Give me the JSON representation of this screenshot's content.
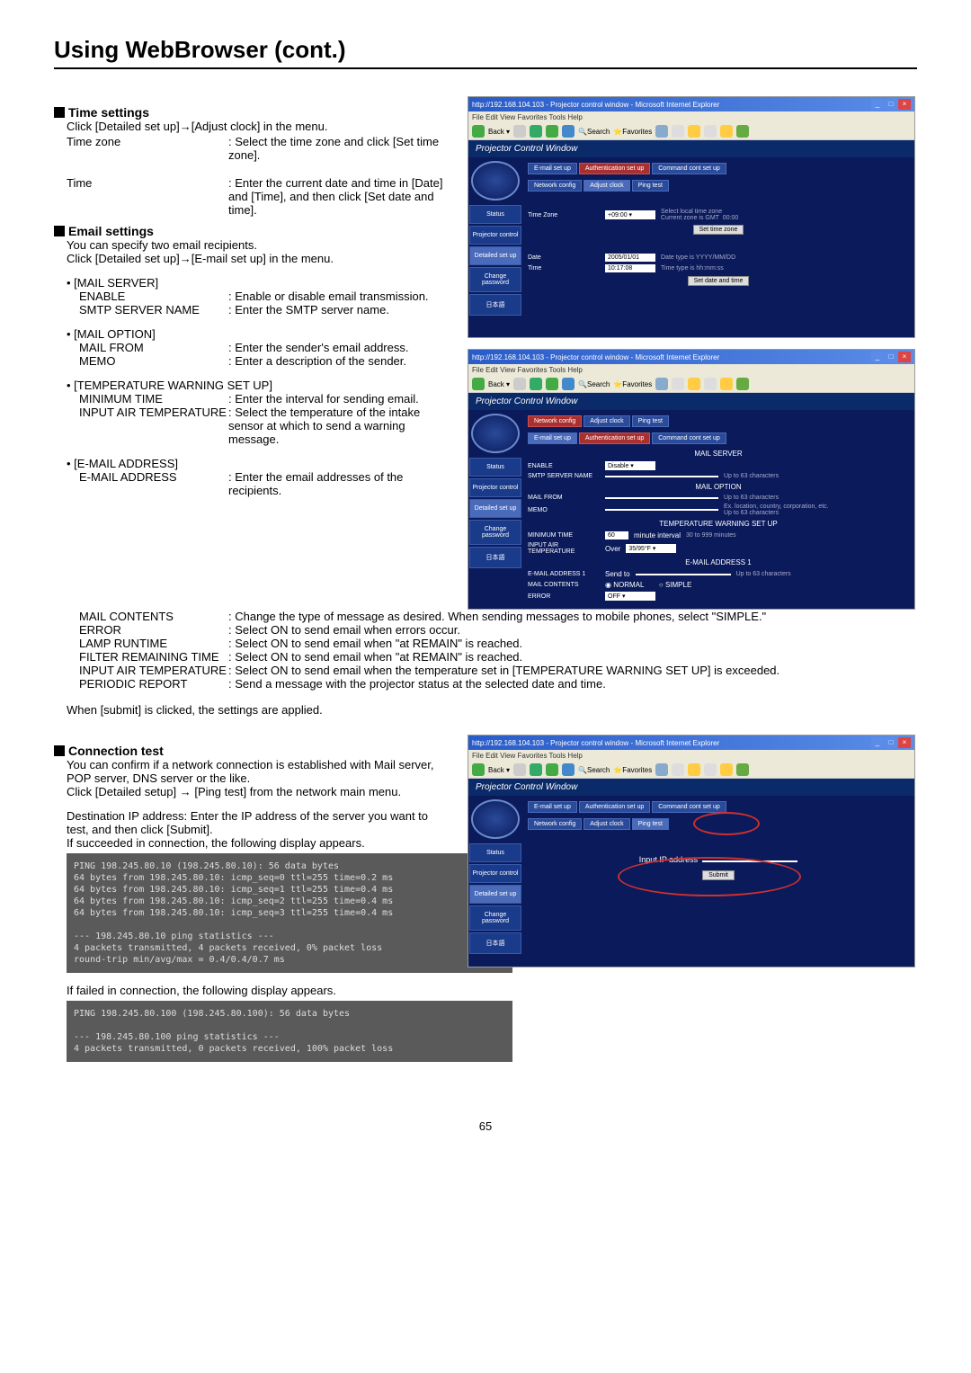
{
  "page_title": "Using WebBrowser (cont.)",
  "page_number": "65",
  "sections": {
    "time": {
      "heading": "Time settings",
      "intro": "Click [Detailed set up]→[Adjust clock] in the menu.",
      "rows": [
        {
          "label": "Time zone",
          "desc": ": Select the time zone and click [Set time zone]."
        },
        {
          "label": "Time",
          "desc": ": Enter the current date and time in [Date] and [Time], and then click [Set date and time]."
        }
      ]
    },
    "email": {
      "heading": "Email settings",
      "intro1": "You can specify two email recipients.",
      "intro2": "Click [Detailed set up]→[E-mail set up] in the menu.",
      "groups": [
        {
          "bullet": "• [MAIL SERVER]",
          "rows": [
            {
              "label": "ENABLE",
              "desc": ": Enable or disable email transmission."
            },
            {
              "label": "SMTP SERVER NAME",
              "desc": ": Enter the SMTP server name."
            }
          ]
        },
        {
          "bullet": "• [MAIL OPTION]",
          "rows": [
            {
              "label": "MAIL FROM",
              "desc": ": Enter the sender's email address."
            },
            {
              "label": "MEMO",
              "desc": ": Enter a description of the sender."
            }
          ]
        },
        {
          "bullet": "• [TEMPERATURE WARNING SET UP]",
          "rows": [
            {
              "label": "MINIMUM TIME",
              "desc": ": Enter the interval for sending email."
            },
            {
              "label": "INPUT AIR TEMPERATURE",
              "desc": ": Select the temperature of the intake sensor at which to send a warning message."
            }
          ]
        },
        {
          "bullet": "• [E-MAIL ADDRESS]",
          "rows": [
            {
              "label": "E-MAIL ADDRESS",
              "desc": ": Enter the email addresses of the recipients."
            },
            {
              "label": "MAIL CONTENTS",
              "desc": ": Change the type of message as desired. When sending messages to mobile phones, select \"SIMPLE.\""
            },
            {
              "label": "ERROR",
              "desc": ": Select ON to send email when errors occur."
            },
            {
              "label": "LAMP RUNTIME",
              "desc": ": Select ON to send email when \"at REMAIN\" is reached."
            },
            {
              "label": "FILTER REMAINING TIME",
              "desc": ": Select ON to send email when \"at REMAIN\" is reached."
            },
            {
              "label": "INPUT AIR TEMPERATURE",
              "desc": ": Select ON to send email when the temperature set in [TEMPERATURE WARNING SET UP] is exceeded."
            },
            {
              "label": "PERIODIC REPORT",
              "desc": ": Send a message with the projector status at the selected date and time."
            }
          ]
        }
      ],
      "footer": "When [submit] is clicked, the settings are applied."
    },
    "connection": {
      "heading": "Connection test",
      "p1": "You can confirm if a network connection is established with Mail server, POP server, DNS server or the like.",
      "p2": "Click [Detailed setup] → [Ping test] from the network main menu.",
      "p3": "Destination IP address: Enter the IP address of the server you want to test, and then click [Submit].",
      "p4": "If succeeded in connection, the following display appears.",
      "ping_ok": "PING 198.245.80.10 (198.245.80.10): 56 data bytes\n64 bytes from 198.245.80.10: icmp_seq=0 ttl=255 time=0.2 ms\n64 bytes from 198.245.80.10: icmp_seq=1 ttl=255 time=0.4 ms\n64 bytes from 198.245.80.10: icmp_seq=2 ttl=255 time=0.4 ms\n64 bytes from 198.245.80.10: icmp_seq=3 ttl=255 time=0.4 ms\n\n--- 198.245.80.10 ping statistics ---\n4 packets transmitted, 4 packets received, 0% packet loss\nround-trip min/avg/max = 0.4/0.4/0.7 ms",
      "p5": "If failed in connection, the following display appears.",
      "ping_fail": "PING 198.245.80.100 (198.245.80.100): 56 data bytes\n\n--- 198.245.80.100 ping statistics ---\n4 packets transmitted, 0 packets received, 100% packet loss"
    }
  },
  "screenshot1": {
    "titlebar": "http://192.168.104.103 - Projector control window - Microsoft Internet Explorer",
    "menubar": "File  Edit  View  Favorites  Tools  Help",
    "pc_title": "Projector Control Window",
    "sidebar": [
      "Status",
      "Projector control",
      "Detailed set up",
      "Change password",
      "日本語"
    ],
    "tabs_top": [
      "E-mail set up",
      "Authentication set up",
      "Command cont set up"
    ],
    "tabs_bottom": [
      "Network config",
      "Adjust clock",
      "Ping test"
    ],
    "rows": {
      "tz_label": "Time Zone",
      "tz_value": "+09:00",
      "tz_hint": "Select local time zone\nCurrent zone is GMT  00:00",
      "tz_btn": "Set time zone",
      "date_label": "Date",
      "date_value": "2005/01/01",
      "date_hint": "Date type is YYYY/MM/DD",
      "time_label": "Time",
      "time_value": "10:17:08",
      "time_hint": "Time type is hh:mm:ss",
      "set_btn": "Set date and time"
    }
  },
  "screenshot2": {
    "titlebar": "http://192.168.104.103 - Projector control window - Microsoft Internet Explorer",
    "menubar": "File  Edit  View  Favorites  Tools  Help",
    "pc_title": "Projector Control Window",
    "sidebar": [
      "Status",
      "Projector control",
      "Detailed set up",
      "Change password",
      "日本語"
    ],
    "tabs_top": [
      "Network config",
      "Adjust clock",
      "Ping test"
    ],
    "tabs_bottom": [
      "E-mail set up",
      "Authentication set up",
      "Command cont set up"
    ],
    "section1": "MAIL SERVER",
    "enable_label": "ENABLE",
    "enable_value": "Disable",
    "smtp_label": "SMTP SERVER NAME",
    "smtp_hint": "Up to 63 characters",
    "section2": "MAIL OPTION",
    "mailfrom_label": "MAIL FROM",
    "mailfrom_hint": "Up to 63 characters",
    "memo_label": "MEMO",
    "memo_hint": "Ex. location, country, corporation, etc.\nUp to 63 characters",
    "section3": "TEMPERATURE WARNING SET UP",
    "mintime_label": "MINIMUM TIME",
    "mintime_value": "60",
    "mintime_unit": "minute interval",
    "mintime_hint": "30 to 999 minutes",
    "inputair_label": "INPUT AIR TEMPERATURE",
    "inputair_prefix": "Over",
    "inputair_value": "35/95°F",
    "section4": "E-MAIL ADDRESS 1",
    "eaddr_label": "E-MAIL ADDRESS 1",
    "eaddr_sendto": "Send to",
    "eaddr_hint": "Up to 63 characters",
    "mailcontents_label": "MAIL CONTENTS",
    "mailcontents_opt1": "NORMAL",
    "mailcontents_opt2": "SIMPLE",
    "error_label": "ERROR",
    "error_value": "OFF"
  },
  "screenshot3": {
    "titlebar": "http://192.168.104.103 - Projector control window - Microsoft Internet Explorer",
    "menubar": "File  Edit  View  Favorites  Tools  Help",
    "pc_title": "Projector Control Window",
    "sidebar": [
      "Status",
      "Projector control",
      "Detailed set up",
      "Change password",
      "日本語"
    ],
    "tabs_top": [
      "E-mail set up",
      "Authentication set up",
      "Command cont set up"
    ],
    "tabs_bottom": [
      "Network config",
      "Adjust clock",
      "Ping test"
    ],
    "ip_label": "Input IP address",
    "submit": "Submit"
  }
}
